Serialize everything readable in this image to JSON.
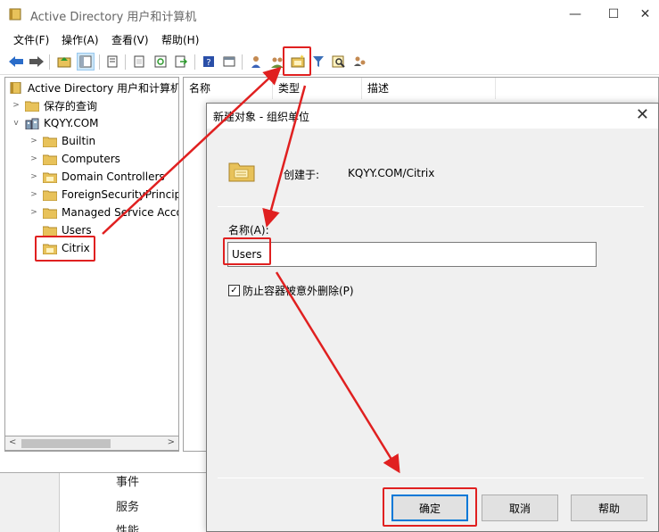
{
  "background_window": {
    "items": [
      "事件",
      "服务",
      "性能"
    ]
  },
  "window": {
    "title": "Active Directory 用户和计算机",
    "controls": {
      "minimize": "—",
      "maximize": "☐",
      "close": "✕"
    }
  },
  "menu": {
    "items": [
      "文件(F)",
      "操作(A)",
      "查看(V)",
      "帮助(H)"
    ]
  },
  "toolbar": {
    "icons": [
      "back-arrow",
      "forward-arrow",
      "up-folder",
      "console-tree",
      "properties",
      "copy",
      "refresh",
      "export",
      "help",
      "view",
      "add-user",
      "add-group",
      "new-ou",
      "filter",
      "find",
      "add-to-group"
    ]
  },
  "tree": {
    "root": "Active Directory 用户和计算机",
    "items": [
      {
        "label": "保存的查询",
        "level": 1,
        "expandable": true
      },
      {
        "label": "KQYY.COM",
        "level": 1,
        "expanded": true
      },
      {
        "label": "Builtin",
        "level": 2,
        "expandable": true
      },
      {
        "label": "Computers",
        "level": 2,
        "expandable": true
      },
      {
        "label": "Domain Controllers",
        "level": 2,
        "expandable": true
      },
      {
        "label": "ForeignSecurityPrincipa",
        "level": 2,
        "expandable": true
      },
      {
        "label": "Managed Service Acco",
        "level": 2,
        "expandable": true
      },
      {
        "label": "Users",
        "level": 2,
        "expandable": false
      },
      {
        "label": "Citrix",
        "level": 2,
        "expandable": false
      }
    ]
  },
  "list": {
    "columns": [
      "名称",
      "类型",
      "描述"
    ]
  },
  "dialog": {
    "title": "新建对象 - 组织单位",
    "create_in_label": "创建于:",
    "create_in_path": "KQYY.COM/Citrix",
    "name_label": "名称(A):",
    "name_value": "Users",
    "protect_label": "防止容器被意外删除(P)",
    "protect_checked": true,
    "buttons": {
      "ok": "确定",
      "cancel": "取消",
      "help": "帮助"
    }
  },
  "colors": {
    "annotation": "#e02020",
    "accent": "#0078d7",
    "folder": "#e8c25a"
  }
}
